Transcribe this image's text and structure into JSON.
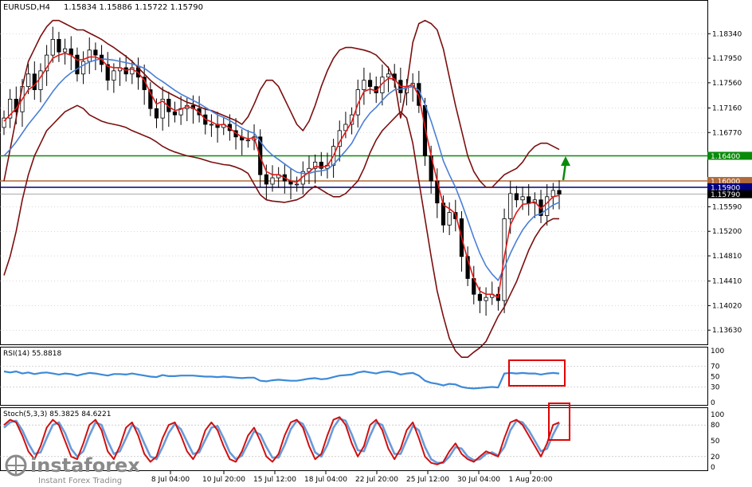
{
  "chart_header": {
    "title": "EURUSD,H4",
    "ohlc": "1.15834 1.15886 1.15722 1.15790"
  },
  "watermark": {
    "brand": "instaforex",
    "tagline": "Instant Forex Trading"
  },
  "colors": {
    "background": "#ffffff",
    "grid": "#b0b0b0",
    "text": "#000000",
    "candle": "#000000",
    "bollinger": "#7a0f0f",
    "ma_fast": "#e01818",
    "ma_slow": "#4a7fd6",
    "resistance_line": "#0a8a0a",
    "level_line": "#b06a3a",
    "bid_line": "#000080",
    "rsi_line": "#3c8ad8",
    "stoch_main": "#d01010",
    "stoch_signal": "#6a9ad8",
    "highlight_box": "#e00000",
    "arrow": "#0a8a0a"
  },
  "chart_data": [
    {
      "type": "line",
      "name": "price",
      "xlabel": "",
      "ylabel": "",
      "grid": true,
      "y_ticks": [
        "1.18340",
        "1.17950",
        "1.17560",
        "1.17160",
        "1.16770",
        "1.15590",
        "1.15200",
        "1.14810",
        "1.14410",
        "1.14020",
        "1.13630"
      ],
      "x_ticks": [
        "8 Jul 04:00",
        "10 Jul 20:00",
        "15 Jul 12:00",
        "18 Jul 04:00",
        "22 Jul 20:00",
        "25 Jul 12:00",
        "30 Jul 04:00",
        "1 Aug 20:00"
      ],
      "ylim": [
        1.1343,
        1.1885
      ],
      "levels": [
        {
          "label": "1.16400",
          "value": 1.164,
          "role": "resistance"
        },
        {
          "label": "1.16000",
          "value": 1.16,
          "role": "level"
        },
        {
          "label": "1.15900",
          "value": 1.159,
          "role": "level"
        },
        {
          "label": "1.15790",
          "value": 1.1579,
          "role": "bid"
        }
      ],
      "close": [
        1.17,
        1.173,
        1.171,
        1.175,
        1.177,
        1.1745,
        1.1775,
        1.18,
        1.1825,
        1.1805,
        1.181,
        1.18,
        1.177,
        1.179,
        1.1808,
        1.18,
        1.1785,
        1.176,
        1.1775,
        1.178,
        1.177,
        1.178,
        1.1765,
        1.1745,
        1.1715,
        1.17,
        1.173,
        1.171,
        1.1705,
        1.1715,
        1.172,
        1.1715,
        1.1705,
        1.169,
        1.169,
        1.1685,
        1.169,
        1.168,
        1.167,
        1.1665,
        1.1665,
        1.167,
        1.161,
        1.1595,
        1.1605,
        1.161,
        1.16,
        1.1595,
        1.1595,
        1.1615,
        1.162,
        1.163,
        1.162,
        1.1625,
        1.1655,
        1.168,
        1.169,
        1.1705,
        1.1745,
        1.176,
        1.175,
        1.174,
        1.1765,
        1.177,
        1.176,
        1.174,
        1.175,
        1.1755,
        1.172,
        1.164,
        1.16,
        1.1565,
        1.153,
        1.155,
        1.154,
        1.148,
        1.1445,
        1.142,
        1.141,
        1.1415,
        1.142,
        1.141,
        1.154,
        1.158,
        1.157,
        1.1575,
        1.1565,
        1.157,
        1.1545,
        1.1575,
        1.1585,
        1.1579
      ],
      "series": [
        {
          "name": "Bollinger upper",
          "values": [
            1.16,
            1.165,
            1.17,
            1.175,
            1.179,
            1.181,
            1.183,
            1.1845,
            1.1855,
            1.1855,
            1.185,
            1.1845,
            1.184,
            1.184,
            1.1835,
            1.183,
            1.1825,
            1.1818,
            1.1812,
            1.1805,
            1.1798,
            1.179,
            1.178,
            1.177,
            1.176,
            1.1752,
            1.1745,
            1.174,
            1.1735,
            1.173,
            1.1725,
            1.1722,
            1.1718,
            1.1714,
            1.1712,
            1.1708,
            1.1704,
            1.17,
            1.1696,
            1.169,
            1.1702,
            1.1722,
            1.1745,
            1.176,
            1.176,
            1.175,
            1.173,
            1.171,
            1.169,
            1.168,
            1.1695,
            1.172,
            1.175,
            1.1775,
            1.1795,
            1.1808,
            1.1812,
            1.1812,
            1.181,
            1.1808,
            1.1805,
            1.18,
            1.179,
            1.178,
            1.176,
            1.17,
            1.175,
            1.182,
            1.185,
            1.1855,
            1.185,
            1.184,
            1.181,
            1.1765,
            1.172,
            1.168,
            1.164,
            1.1615,
            1.16,
            1.159,
            1.159,
            1.16,
            1.161,
            1.1615,
            1.162,
            1.163,
            1.1645,
            1.1655,
            1.166,
            1.166,
            1.1655,
            1.165
          ]
        },
        {
          "name": "Bollinger lower",
          "values": [
            1.145,
            1.148,
            1.152,
            1.157,
            1.161,
            1.164,
            1.166,
            1.168,
            1.169,
            1.17,
            1.171,
            1.1715,
            1.172,
            1.1715,
            1.1705,
            1.17,
            1.1695,
            1.1692,
            1.169,
            1.1688,
            1.1685,
            1.168,
            1.1676,
            1.1672,
            1.1668,
            1.1662,
            1.1655,
            1.165,
            1.1646,
            1.1643,
            1.164,
            1.1638,
            1.1636,
            1.1633,
            1.163,
            1.1628,
            1.1626,
            1.1625,
            1.1622,
            1.1618,
            1.1612,
            1.1595,
            1.1578,
            1.157,
            1.1568,
            1.1567,
            1.1566,
            1.1568,
            1.157,
            1.1575,
            1.1585,
            1.1592,
            1.1586,
            1.158,
            1.1575,
            1.1575,
            1.158,
            1.159,
            1.16,
            1.162,
            1.1645,
            1.1665,
            1.168,
            1.169,
            1.17,
            1.171,
            1.17,
            1.166,
            1.16,
            1.154,
            1.148,
            1.1425,
            1.1385,
            1.135,
            1.133,
            1.132,
            1.132,
            1.1328,
            1.1335,
            1.1345,
            1.1365,
            1.1385,
            1.14,
            1.142,
            1.144,
            1.1465,
            1.149,
            1.151,
            1.1525,
            1.1535,
            1.154,
            1.154
          ]
        },
        {
          "name": "Fast MA",
          "values": [
            1.1695,
            1.1705,
            1.1715,
            1.173,
            1.1745,
            1.1752,
            1.1765,
            1.178,
            1.1795,
            1.18,
            1.1803,
            1.18,
            1.1792,
            1.1793,
            1.1797,
            1.1797,
            1.1793,
            1.1782,
            1.178,
            1.178,
            1.1776,
            1.1778,
            1.1772,
            1.176,
            1.174,
            1.1722,
            1.1727,
            1.1718,
            1.1712,
            1.1714,
            1.1718,
            1.1716,
            1.1709,
            1.1698,
            1.1694,
            1.1689,
            1.169,
            1.1684,
            1.1676,
            1.167,
            1.1667,
            1.1669,
            1.1638,
            1.1615,
            1.161,
            1.161,
            1.1605,
            1.16,
            1.1598,
            1.1607,
            1.1614,
            1.1623,
            1.1622,
            1.1624,
            1.164,
            1.1662,
            1.1678,
            1.1694,
            1.1722,
            1.1742,
            1.1746,
            1.1743,
            1.1755,
            1.1763,
            1.1762,
            1.175,
            1.175,
            1.1753,
            1.1735,
            1.1685,
            1.164,
            1.16,
            1.1562,
            1.1556,
            1.1548,
            1.151,
            1.1475,
            1.1445,
            1.1425,
            1.142,
            1.142,
            1.1415,
            1.148,
            1.153,
            1.155,
            1.1563,
            1.1564,
            1.1567,
            1.1556,
            1.1565,
            1.1575,
            1.1577
          ]
        },
        {
          "name": "Slow MA",
          "values": [
            1.164,
            1.165,
            1.1662,
            1.1676,
            1.169,
            1.1702,
            1.1714,
            1.1728,
            1.1742,
            1.1754,
            1.1764,
            1.1772,
            1.1778,
            1.1784,
            1.1789,
            1.1792,
            1.1794,
            1.1793,
            1.1792,
            1.179,
            1.1788,
            1.1786,
            1.1783,
            1.1779,
            1.1772,
            1.1764,
            1.1758,
            1.1751,
            1.1744,
            1.1738,
            1.1733,
            1.1728,
            1.1723,
            1.1717,
            1.1711,
            1.1705,
            1.1701,
            1.1696,
            1.169,
            1.1684,
            1.1679,
            1.1676,
            1.1663,
            1.165,
            1.1641,
            1.1634,
            1.1627,
            1.162,
            1.1614,
            1.1612,
            1.1612,
            1.1615,
            1.1616,
            1.1618,
            1.1626,
            1.1637,
            1.1648,
            1.166,
            1.1678,
            1.1695,
            1.1708,
            1.1717,
            1.1728,
            1.1738,
            1.1745,
            1.1746,
            1.1748,
            1.175,
            1.1744,
            1.1722,
            1.1695,
            1.1665,
            1.1632,
            1.161,
            1.159,
            1.1565,
            1.1538,
            1.151,
            1.1485,
            1.1465,
            1.1452,
            1.1442,
            1.1462,
            1.1485,
            1.1505,
            1.1522,
            1.1535,
            1.1545,
            1.1548,
            1.1555,
            1.1562,
            1.1566
          ]
        }
      ]
    },
    {
      "type": "line",
      "name": "RSI",
      "label": "RSI(14) 55.8818",
      "ylim": [
        0,
        100
      ],
      "y_ticks": [
        "100",
        "70",
        "50",
        "30",
        "0"
      ],
      "levels": [
        70,
        30
      ],
      "series": [
        {
          "name": "RSI",
          "values": [
            60,
            58,
            60,
            56,
            58,
            55,
            57,
            58,
            56,
            54,
            56,
            55,
            52,
            55,
            57,
            56,
            54,
            52,
            55,
            55,
            54,
            56,
            54,
            52,
            50,
            49,
            53,
            51,
            51,
            52,
            52,
            52,
            51,
            50,
            50,
            49,
            50,
            49,
            48,
            47,
            48,
            48,
            42,
            41,
            43,
            44,
            43,
            42,
            42,
            44,
            46,
            47,
            45,
            46,
            49,
            52,
            53,
            54,
            58,
            60,
            58,
            56,
            59,
            60,
            58,
            54,
            56,
            57,
            52,
            42,
            38,
            36,
            33,
            36,
            35,
            30,
            28,
            27,
            28,
            29,
            30,
            29,
            56,
            57,
            56,
            57,
            56,
            56,
            54,
            56,
            57,
            56
          ]
        }
      ]
    },
    {
      "type": "line",
      "name": "Stochastic",
      "label": "Stoch(5,3,3) 85.3825 84.6221",
      "ylim": [
        0,
        100
      ],
      "y_ticks": [
        "100",
        "80",
        "50",
        "20",
        "0"
      ],
      "levels": [
        80,
        20
      ],
      "series": [
        {
          "name": "Stoch main",
          "values": [
            80,
            90,
            85,
            60,
            30,
            15,
            40,
            75,
            90,
            80,
            50,
            20,
            15,
            45,
            80,
            90,
            70,
            30,
            15,
            40,
            75,
            85,
            60,
            25,
            10,
            20,
            55,
            80,
            85,
            60,
            30,
            15,
            35,
            70,
            85,
            70,
            40,
            15,
            10,
            30,
            60,
            75,
            50,
            20,
            10,
            25,
            60,
            85,
            90,
            75,
            40,
            15,
            25,
            60,
            90,
            95,
            80,
            45,
            20,
            40,
            80,
            90,
            70,
            35,
            15,
            35,
            70,
            85,
            55,
            20,
            8,
            5,
            10,
            30,
            45,
            25,
            15,
            10,
            20,
            30,
            25,
            20,
            55,
            85,
            90,
            80,
            60,
            40,
            20,
            45,
            80,
            85
          ]
        },
        {
          "name": "Stoch signal",
          "values": [
            75,
            85,
            88,
            70,
            45,
            25,
            28,
            55,
            80,
            85,
            65,
            35,
            20,
            30,
            60,
            85,
            80,
            50,
            25,
            30,
            55,
            80,
            72,
            45,
            20,
            15,
            38,
            65,
            82,
            72,
            48,
            25,
            28,
            52,
            75,
            78,
            55,
            28,
            15,
            22,
            45,
            68,
            62,
            38,
            18,
            18,
            42,
            72,
            88,
            82,
            58,
            28,
            20,
            42,
            75,
            92,
            88,
            62,
            32,
            30,
            60,
            85,
            80,
            52,
            25,
            25,
            52,
            78,
            70,
            38,
            15,
            8,
            8,
            20,
            38,
            35,
            20,
            13,
            15,
            25,
            28,
            22,
            38,
            70,
            88,
            85,
            70,
            50,
            30,
            35,
            62,
            84
          ]
        }
      ]
    }
  ]
}
